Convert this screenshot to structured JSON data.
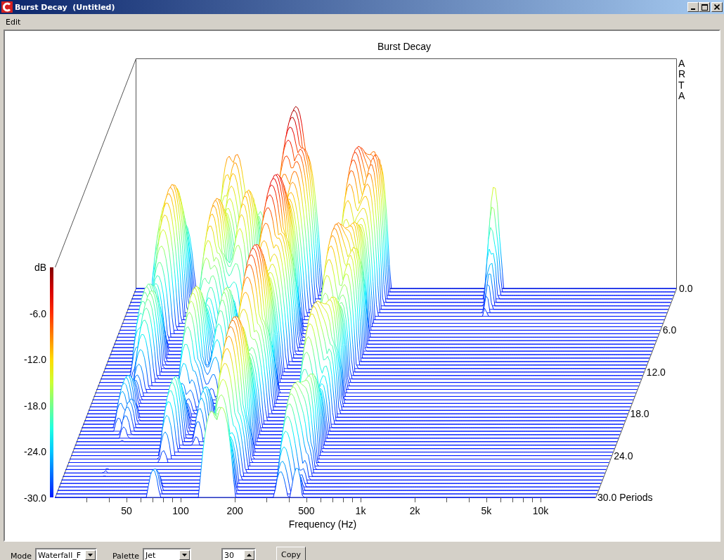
{
  "window": {
    "title": "Burst Decay  (Untitled)"
  },
  "menu": [
    {
      "label": "Edit"
    }
  ],
  "plot": {
    "title": "Burst Decay",
    "brand_label": "ARTA",
    "color_scale": {
      "unit": "dB",
      "ticks": [
        "-6.0",
        "-12.0",
        "-18.0",
        "-24.0",
        "-30.0"
      ]
    },
    "time_ticks": [
      "0.0",
      "6.0",
      "12.0",
      "18.0",
      "24.0",
      "30.0 Periods"
    ],
    "freq_ticks": [
      "50",
      "100",
      "200",
      "500",
      "1k",
      "2k",
      "5k",
      "10k"
    ],
    "xlabel": "Frequency (Hz)"
  },
  "controls": {
    "mode": {
      "label": "Mode",
      "value": "Waterfall_F"
    },
    "palette": {
      "label": "Palette",
      "value": "Jet"
    },
    "periods": {
      "value": "30"
    },
    "copy_button": "Copy"
  }
}
